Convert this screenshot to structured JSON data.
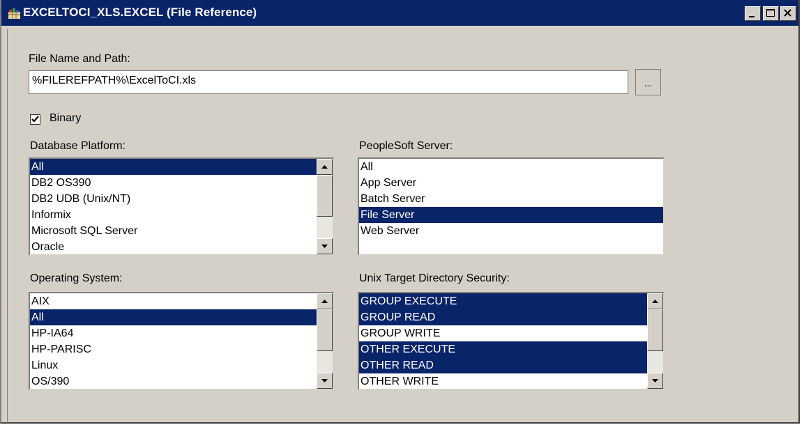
{
  "window": {
    "title": "EXCELTOCI_XLS.EXCEL (File Reference)",
    "titlebar_color": "#0a246a",
    "selection_color": "#0a246a"
  },
  "file": {
    "label": "File Name and Path:",
    "value": "%FILEREFPATH%\\ExcelToCI.xls",
    "browse_label": "..."
  },
  "binary": {
    "label": "Binary",
    "checked": true
  },
  "database_platform": {
    "label": "Database Platform:",
    "items": [
      "All",
      "DB2 OS390",
      "DB2 UDB (Unix/NT)",
      "Informix",
      "Microsoft SQL Server",
      "Oracle"
    ],
    "selected": [
      0
    ]
  },
  "peoplesoft_server": {
    "label": "PeopleSoft Server:",
    "items": [
      "All",
      "App Server",
      "Batch Server",
      "File Server",
      "Web Server"
    ],
    "selected": [
      3
    ]
  },
  "operating_system": {
    "label": "Operating System:",
    "items": [
      "AIX",
      "All",
      "HP-IA64",
      "HP-PARISC",
      "Linux",
      "OS/390"
    ],
    "selected": [
      1
    ]
  },
  "unix_security": {
    "label": "Unix Target Directory Security:",
    "items": [
      "GROUP EXECUTE",
      "GROUP READ",
      "GROUP WRITE",
      "OTHER EXECUTE",
      "OTHER READ",
      "OTHER WRITE"
    ],
    "selected": [
      0,
      1,
      3,
      4
    ]
  }
}
